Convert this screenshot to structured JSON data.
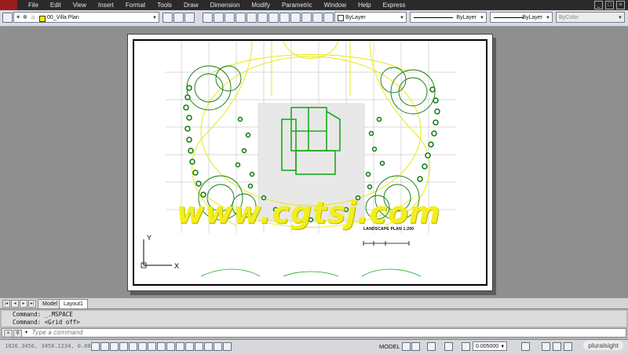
{
  "menubar": {
    "items": [
      "File",
      "Edit",
      "View",
      "Insert",
      "Format",
      "Tools",
      "Draw",
      "Dimension",
      "Modify",
      "Parametric",
      "Window",
      "Help",
      "Express"
    ],
    "window_buttons": [
      "_",
      "□",
      "×"
    ]
  },
  "toolbar": {
    "layer_name": "00_Villa Plan",
    "color": "ByLayer",
    "linetype": "ByLayer",
    "lineweight": "ByLayer",
    "plotstyle": "ByColor"
  },
  "drawing": {
    "title": "LANDSCAPE PLAN   1:200",
    "ucs_y": "Y",
    "ucs_x": "X",
    "watermark": "www.cgtsj.com",
    "colors": {
      "green": "#1ea81e",
      "yellow": "#e4e800",
      "dark_green": "#0a7a0a",
      "grid": "#b4b4b4"
    }
  },
  "tabs": [
    {
      "label": "Model",
      "active": false
    },
    {
      "label": "Layout1",
      "active": true
    }
  ],
  "command": {
    "history": [
      "Command:  _.MSPACE",
      "Command:  <Grid off>"
    ],
    "placeholder": "Type a command"
  },
  "status": {
    "coords": "1026.3456, 3458.1234, 0.0000",
    "space": "MODEL",
    "scale": "0.005000",
    "brand": "pluralsight"
  }
}
